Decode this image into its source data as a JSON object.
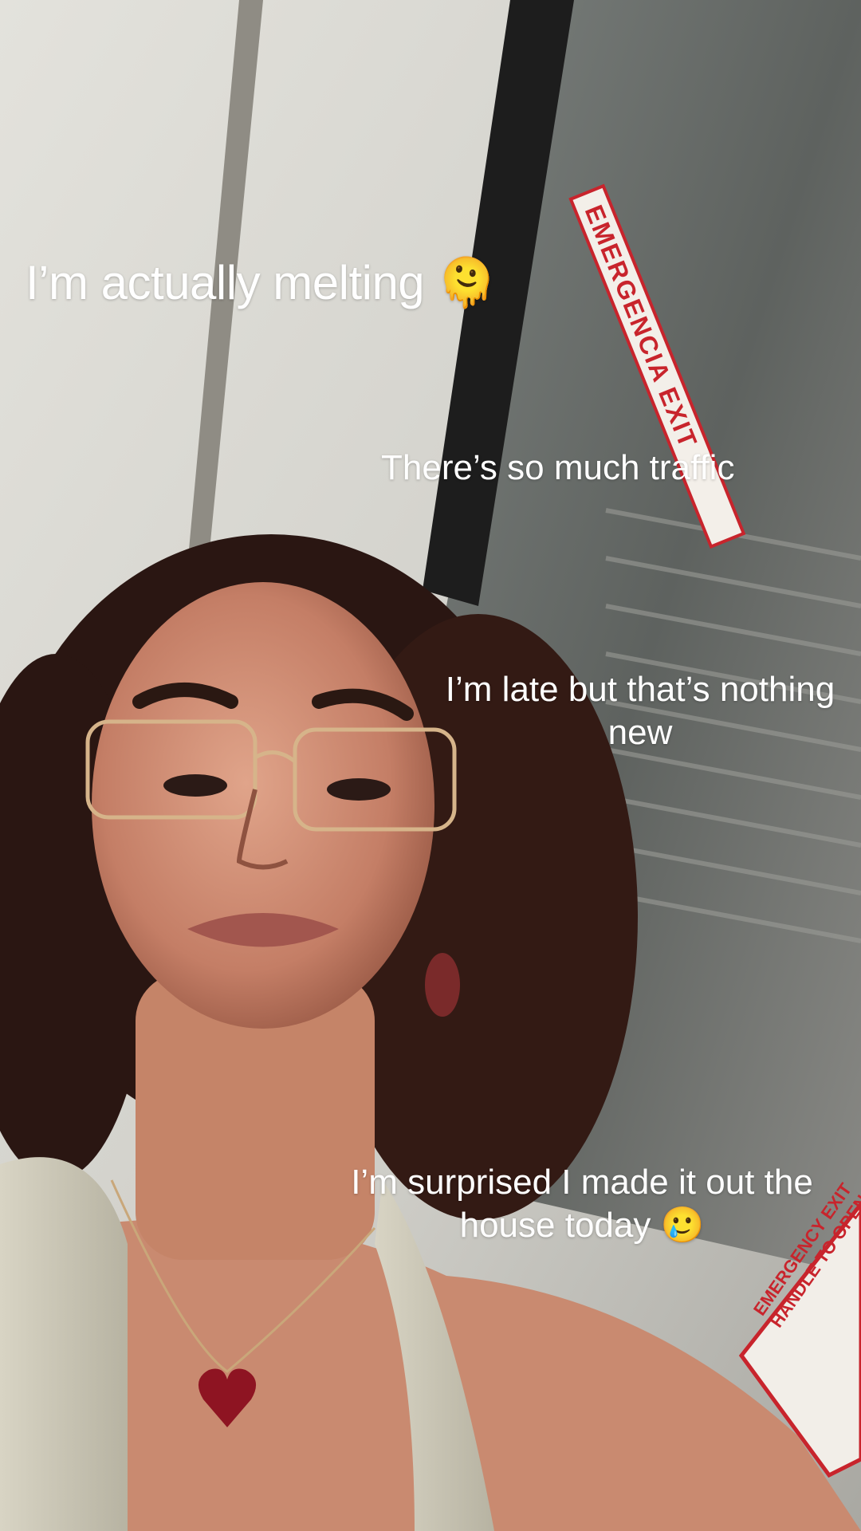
{
  "captions": {
    "melting": "I’m actually melting 🫠",
    "traffic": "There’s so much traffic",
    "late": {
      "line1": "I’m late but that’s nothing",
      "line2": "new"
    },
    "surprised": {
      "line1": "I’m surprised I made it out the",
      "line2": "house today 🥲"
    }
  },
  "signage": {
    "emergency_exit": "EMERGENCIA EXIT",
    "emergency_handle": "EMERGENCY EXIT HANDLE TO OPEN"
  },
  "colors": {
    "caption_text": "#ffffff",
    "ceiling": "#d9d8d2",
    "sign_red": "#c8242c",
    "necklace_heart": "#8e1422"
  }
}
